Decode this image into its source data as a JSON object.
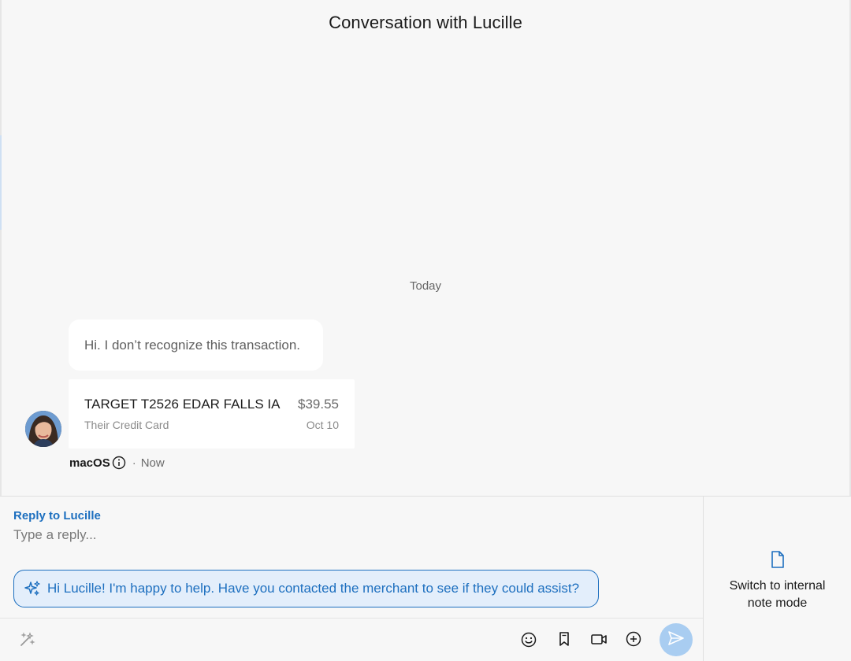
{
  "header": {
    "title": "Conversation with Lucille"
  },
  "thread": {
    "day_separator": "Today",
    "message": {
      "text": "Hi. I don’t recognize this transaction."
    },
    "transaction": {
      "merchant": "TARGET T2526 EDAR FALLS IA",
      "amount": "$39.55",
      "account": "Their Credit Card",
      "date": "Oct 10"
    },
    "meta": {
      "source": "macOS",
      "separator": "·",
      "time": "Now"
    }
  },
  "composer": {
    "reply_label": "Reply to Lucille",
    "placeholder": "Type a reply...",
    "value": "",
    "suggestion": "Hi Lucille! I'm happy to help. Have you contacted the merchant to see if they could assist?",
    "tools": [
      "magic-wand-icon",
      "emoji-icon",
      "bookmark-icon",
      "video-icon",
      "add-circle-icon",
      "send-icon"
    ]
  },
  "side_panel": {
    "label": "Switch to internal note mode",
    "icon": "document-icon"
  },
  "colors": {
    "accent": "#1d6fbf",
    "suggestion_bg": "#e3eefb",
    "send_bg": "#a9cdf1"
  }
}
